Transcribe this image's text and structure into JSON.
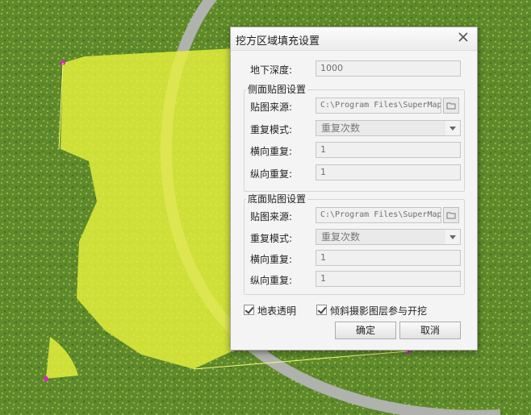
{
  "dialog": {
    "title": "挖方区域填充设置",
    "close_icon": "close-icon",
    "depth": {
      "label": "地下深度:",
      "value": "1000"
    },
    "side_group": {
      "title": "侧面贴图设置",
      "source_label": "贴图来源:",
      "source_value": "C:\\Program Files\\SuperMap",
      "repeat_mode_label": "重复模式:",
      "repeat_mode_value": "重复次数",
      "h_repeat_label": "横向重复:",
      "h_repeat_value": "1",
      "v_repeat_label": "纵向重复:",
      "v_repeat_value": "1"
    },
    "bottom_group": {
      "title": "底面贴图设置",
      "source_label": "贴图来源:",
      "source_value": "C:\\Program Files\\SuperMap",
      "repeat_mode_label": "重复模式:",
      "repeat_mode_value": "重复次数",
      "h_repeat_label": "横向重复:",
      "h_repeat_value": "1",
      "v_repeat_label": "纵向重复:",
      "v_repeat_value": "1"
    },
    "checkboxes": {
      "surface_transparent": {
        "label": "地表透明",
        "checked": true
      },
      "oblique_layer": {
        "label": "倾斜摄影图层参与开挖",
        "checked": true
      }
    },
    "ok_label": "确定",
    "cancel_label": "取消"
  },
  "colors": {
    "grass": "#5e8a2c",
    "fill_yellow": "#e6f23c",
    "road_gray": "#b4b4b4",
    "vertex_magenta": "#e020c8"
  }
}
